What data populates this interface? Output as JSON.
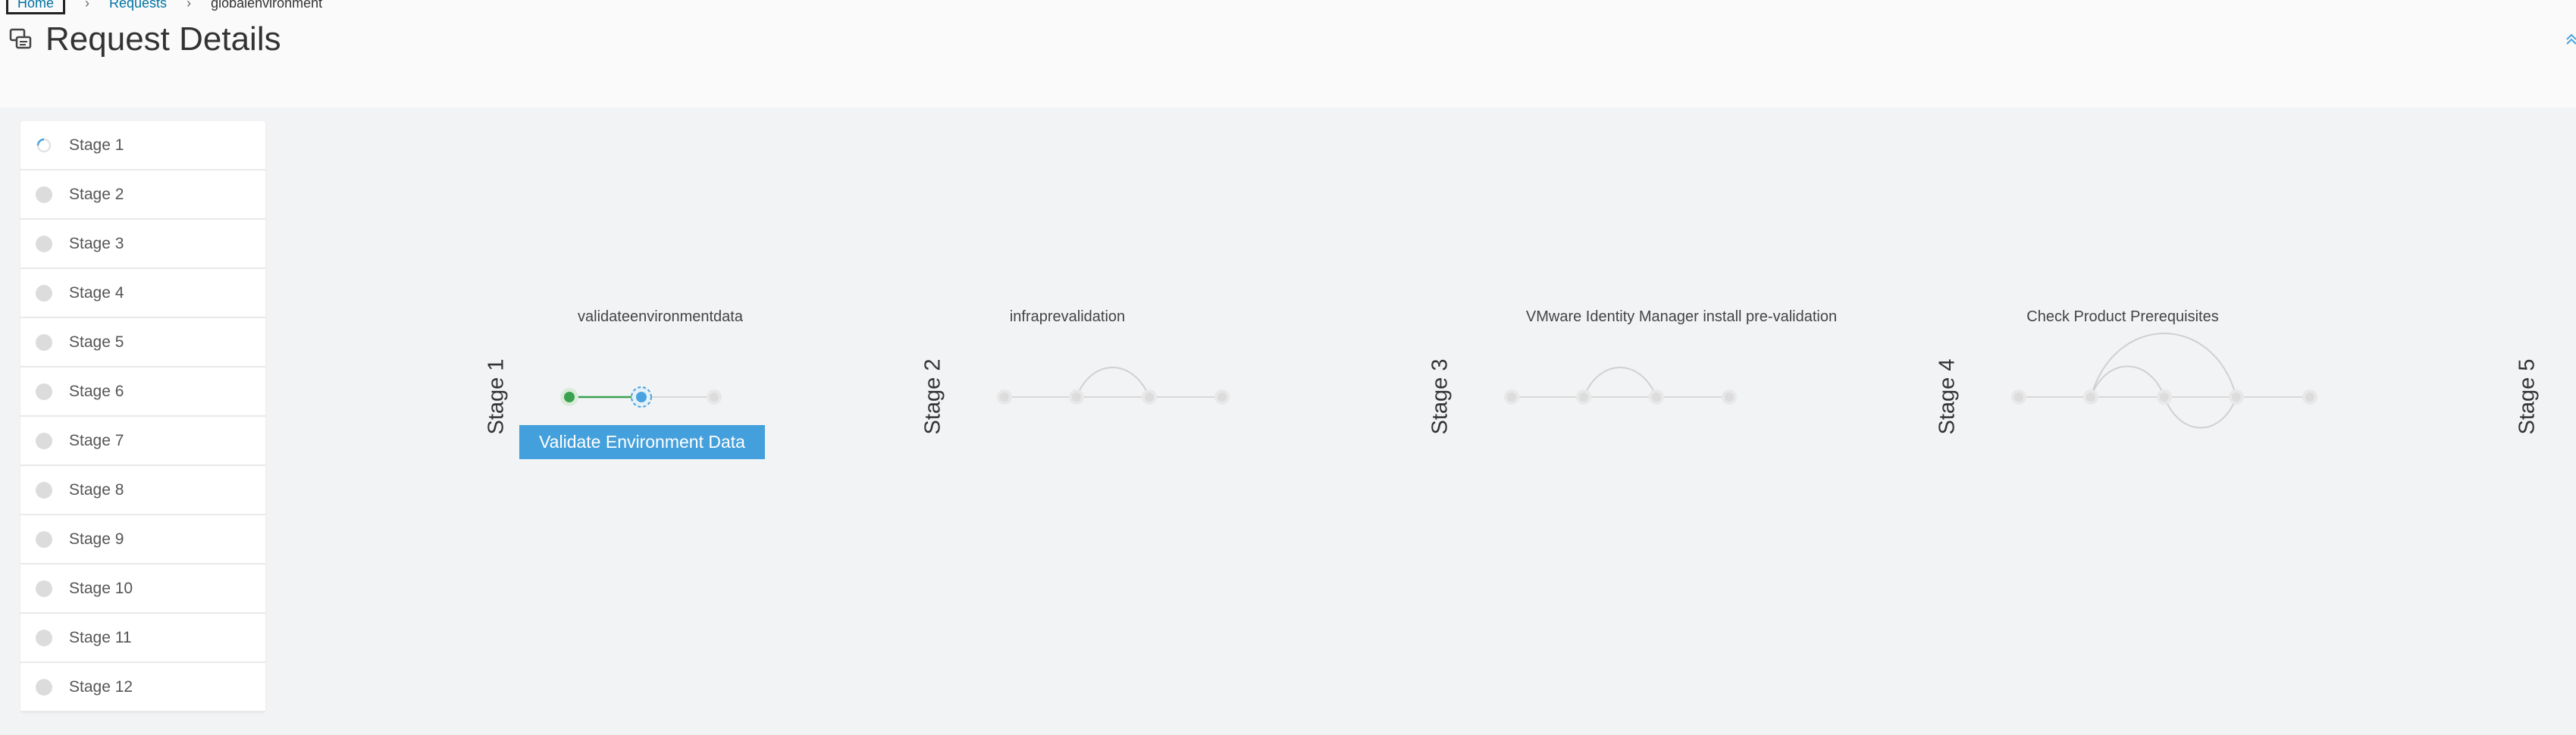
{
  "breadcrumb": {
    "home": "Home",
    "requests": "Requests",
    "current": "globalenvironment"
  },
  "header": {
    "title": "Request Details"
  },
  "sidebar": {
    "stages": [
      {
        "label": "Stage 1",
        "status": "in-progress"
      },
      {
        "label": "Stage 2",
        "status": "pending"
      },
      {
        "label": "Stage 3",
        "status": "pending"
      },
      {
        "label": "Stage 4",
        "status": "pending"
      },
      {
        "label": "Stage 5",
        "status": "pending"
      },
      {
        "label": "Stage 6",
        "status": "pending"
      },
      {
        "label": "Stage 7",
        "status": "pending"
      },
      {
        "label": "Stage 8",
        "status": "pending"
      },
      {
        "label": "Stage 9",
        "status": "pending"
      },
      {
        "label": "Stage 10",
        "status": "pending"
      },
      {
        "label": "Stage 11",
        "status": "pending"
      },
      {
        "label": "Stage 12",
        "status": "pending"
      }
    ]
  },
  "pipeline": {
    "stages": [
      {
        "label": "Stage 1",
        "task": "validateenvironmentdata"
      },
      {
        "label": "Stage 2",
        "task": "infraprevalidation"
      },
      {
        "label": "Stage 3",
        "task": "VMware Identity Manager install pre-validation"
      },
      {
        "label": "Stage 4",
        "task": "Check Product Prerequisites"
      },
      {
        "label": "Stage 5",
        "task": ""
      }
    ],
    "tooltip": "Validate Environment Data"
  },
  "colors": {
    "accent": "#0072a3",
    "complete": "#3aa14f",
    "active": "#49a3e0",
    "pending": "#dcdcdc",
    "tooltip_bg": "#44a0dc"
  }
}
